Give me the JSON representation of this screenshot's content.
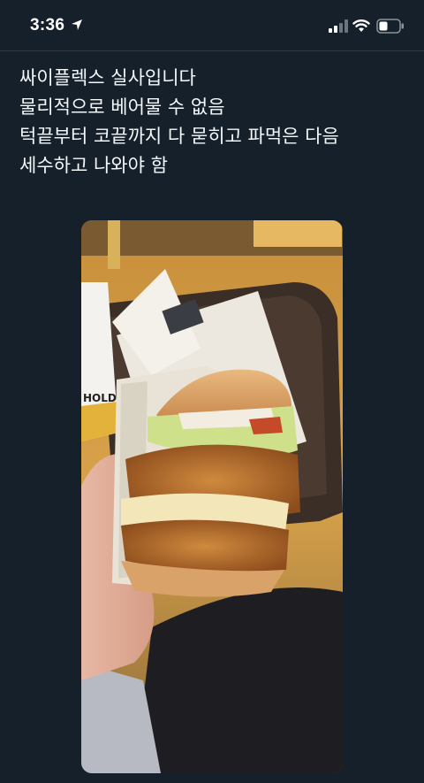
{
  "status_bar": {
    "time": "3:36",
    "icons": [
      "location-arrow-icon",
      "cellular-signal-icon",
      "wifi-icon",
      "battery-icon"
    ]
  },
  "tweet": {
    "lines": [
      "싸이플렉스 실사입니다",
      "물리적으로 베어물 수 없음",
      "턱끝부터 코끝까지 다 묻히고 파먹은 다음",
      "세수하고 나와야 함"
    ],
    "wrapper_text": "HOLD!",
    "image": {
      "subject": "hand holding a tall double chicken burger in a paper wrapper over a food tray"
    }
  },
  "colors": {
    "background": "#15202b",
    "text": "#f5f8fa"
  }
}
